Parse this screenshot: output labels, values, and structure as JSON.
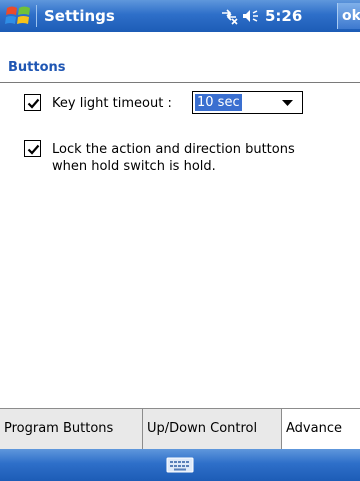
{
  "title_bar": {
    "start_icon": "windows-flag-icon",
    "title": "Settings",
    "connectivity_icon": "connectivity-icon",
    "volume_icon": "speaker-icon",
    "clock": "5:26",
    "ok_label": "ok"
  },
  "page": {
    "header": "Buttons"
  },
  "options": {
    "key_light": {
      "checked": true,
      "label": "Key light timeout :",
      "selected_value": "10 sec"
    },
    "lock_buttons": {
      "checked": true,
      "label_line1": "Lock the action and direction buttons",
      "label_line2": "when hold switch is hold."
    }
  },
  "tabs": [
    {
      "label": "Program Buttons",
      "active": false
    },
    {
      "label": "Up/Down Control",
      "active": false
    },
    {
      "label": "Advance",
      "active": true
    }
  ],
  "menu_bar": {
    "keyboard_icon": "keyboard-icon"
  },
  "colors": {
    "titlebar_blue": "#2e6fc9",
    "header_text_blue": "#1f56b3",
    "selection_blue": "#3a6fd0"
  }
}
